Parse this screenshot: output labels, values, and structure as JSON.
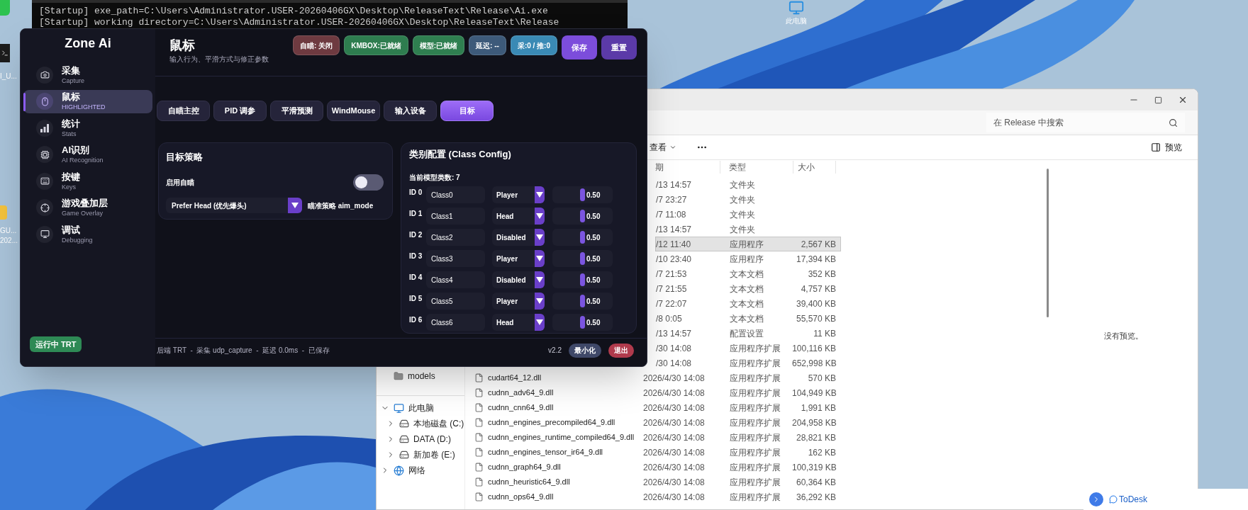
{
  "console": {
    "lines": [
      "[Startup] exe_path=C:\\Users\\Administrator.USER-20260406GX\\Desktop\\ReleaseText\\Release\\Ai.exe",
      "[Startup] working directory=C:\\Users\\Administrator.USER-20260406GX\\Desktop\\ReleaseText\\Release"
    ]
  },
  "desktop": {
    "icons": [
      {
        "label": "此电脑"
      }
    ],
    "edge_labels": [
      "I_U...",
      "GU...",
      "202..."
    ]
  },
  "app": {
    "brand": "Zone Ai",
    "nav": [
      {
        "label": "采集",
        "sub": "Capture",
        "selected": false
      },
      {
        "label": "鼠标",
        "sub": "HIGHLIGHTED",
        "selected": true
      },
      {
        "label": "统计",
        "sub": "Stats",
        "selected": false
      },
      {
        "label": "AI识别",
        "sub": "AI Recognition",
        "selected": false
      },
      {
        "label": "按键",
        "sub": "Keys",
        "selected": false
      },
      {
        "label": "游戏叠加层",
        "sub": "Game Overlay",
        "selected": false
      },
      {
        "label": "调试",
        "sub": "Debugging",
        "selected": false
      }
    ],
    "run_button": "运行中 TRT",
    "header": {
      "title": "鼠标",
      "subtitle": "输入行为、平滑方式与修正参数"
    },
    "status_pills": [
      {
        "label": "自瞄: 关闭",
        "color": "#6e3a40"
      },
      {
        "label": "KMBOX:已就绪",
        "color": "#2e7d4f"
      },
      {
        "label": "模型:已就绪",
        "color": "#2f7f50"
      },
      {
        "label": "延迟: --",
        "color": "#3d5a7a"
      },
      {
        "label": "采:0 / 推:0",
        "color": "#3a8ab5"
      }
    ],
    "actions": [
      "保存",
      "重置"
    ],
    "tabs": [
      {
        "label": "自瞄主控",
        "selected": false
      },
      {
        "label": "PID 调参",
        "selected": false
      },
      {
        "label": "平滑预测",
        "selected": false
      },
      {
        "label": "WindMouse",
        "selected": false
      },
      {
        "label": "输入设备",
        "selected": false
      },
      {
        "label": "目标",
        "selected": true
      }
    ],
    "target_panel": {
      "title": "目标策略",
      "toggle": {
        "label": "启用自瞄",
        "on": false
      },
      "select": {
        "value": "Prefer Head (优先爆头)",
        "label": "瞄准策略 aim_mode"
      }
    },
    "class_panel": {
      "title": "类别配置 (Class Config)",
      "count": "当前模型类数: 7",
      "rows": [
        {
          "id": "ID 0",
          "name": "Class0",
          "type": "Player",
          "reading": "0.50",
          "level": 0.5
        },
        {
          "id": "ID 1",
          "name": "Class1",
          "type": "Head",
          "reading": "0.50",
          "level": 0.5
        },
        {
          "id": "ID 2",
          "name": "Class2",
          "type": "Disabled",
          "reading": "0.50",
          "level": 0.5
        },
        {
          "id": "ID 3",
          "name": "Class3",
          "type": "Player",
          "reading": "0.50",
          "level": 0.5
        },
        {
          "id": "ID 4",
          "name": "Class4",
          "type": "Disabled",
          "reading": "0.50",
          "level": 0.5
        },
        {
          "id": "ID 5",
          "name": "Class5",
          "type": "Player",
          "reading": "0.50",
          "level": 0.5
        },
        {
          "id": "ID 6",
          "name": "Class6",
          "type": "Head",
          "reading": "0.50",
          "level": 0.5
        }
      ]
    },
    "status_bar": {
      "text": "后端 TRT  -  采集 udp_capture  -  延迟 0.0ms  -  已保存",
      "version": "v2.2",
      "buttons": [
        {
          "label": "最小化",
          "kind": "neutral"
        },
        {
          "label": "退出",
          "kind": "danger"
        }
      ]
    }
  },
  "explorer": {
    "search": {
      "placeholder": "在 Release 中搜索"
    },
    "toolbar": {
      "view": "查看",
      "preview": "预览"
    },
    "nav": [
      {
        "label": "models",
        "kind": "folder"
      },
      {
        "label": "此电脑",
        "kind": "pc",
        "expanded": true,
        "children": [
          {
            "label": "本地磁盘 (C:)",
            "kind": "drive",
            "expanded": false
          },
          {
            "label": "DATA (D:)",
            "kind": "drive",
            "expanded": false
          },
          {
            "label": "新加卷 (E:)",
            "kind": "drive",
            "expanded": false
          }
        ]
      },
      {
        "label": "网络",
        "kind": "network",
        "expanded": false
      }
    ],
    "columns": [
      "期",
      "类型",
      "大小"
    ],
    "rows": [
      {
        "date": "/13 14:57",
        "type": "文件夹",
        "selected": false
      },
      {
        "date": "/7 23:27",
        "type": "文件夹",
        "selected": false
      },
      {
        "date": "/7 11:08",
        "type": "文件夹",
        "selected": false
      },
      {
        "date": "/13 14:57",
        "type": "文件夹",
        "selected": false
      },
      {
        "date": "/12 11:40",
        "type": "应用程序",
        "size": "2,567 KB",
        "selected": true
      },
      {
        "date": "/10 23:40",
        "type": "应用程序",
        "size": "17,394 KB",
        "selected": false
      },
      {
        "date": "/7 21:53",
        "type": "文本文档",
        "size": "352 KB",
        "selected": false
      },
      {
        "date": "/7 21:55",
        "type": "文本文档",
        "size": "4,757 KB",
        "selected": false
      },
      {
        "date": "/7 22:07",
        "type": "文本文档",
        "size": "39,400 KB",
        "selected": false
      },
      {
        "date": "/8 0:05",
        "type": "文本文档",
        "size": "55,570 KB",
        "selected": false
      },
      {
        "date": "/13 14:57",
        "type": "配置设置",
        "size": "11 KB",
        "selected": false
      },
      {
        "date": "/30 14:08",
        "type": "应用程序扩展",
        "size": "100,116 KB",
        "selected": false
      },
      {
        "date": "/30 14:08",
        "type": "应用程序扩展",
        "size": "652,998 KB",
        "selected": false
      },
      {
        "name": "cudart64_12.dll",
        "date": "2026/4/30 14:08",
        "type": "应用程序扩展",
        "size": "570 KB",
        "selected": false
      },
      {
        "name": "cudnn_adv64_9.dll",
        "date": "2026/4/30 14:08",
        "type": "应用程序扩展",
        "size": "104,949 KB",
        "selected": false
      },
      {
        "name": "cudnn_cnn64_9.dll",
        "date": "2026/4/30 14:08",
        "type": "应用程序扩展",
        "size": "1,991 KB",
        "selected": false
      },
      {
        "name": "cudnn_engines_precompiled64_9.dll",
        "date": "2026/4/30 14:08",
        "type": "应用程序扩展",
        "size": "204,958 KB",
        "selected": false
      },
      {
        "name": "cudnn_engines_runtime_compiled64_9.dll",
        "date": "2026/4/30 14:08",
        "type": "应用程序扩展",
        "size": "28,821 KB",
        "selected": false
      },
      {
        "name": "cudnn_engines_tensor_ir64_9.dll",
        "date": "2026/4/30 14:08",
        "type": "应用程序扩展",
        "size": "162 KB",
        "selected": false
      },
      {
        "name": "cudnn_graph64_9.dll",
        "date": "2026/4/30 14:08",
        "type": "应用程序扩展",
        "size": "100,319 KB",
        "selected": false
      },
      {
        "name": "cudnn_heuristic64_9.dll",
        "date": "2026/4/30 14:08",
        "type": "应用程序扩展",
        "size": "60,364 KB",
        "selected": false
      },
      {
        "name": "cudnn_ops64_9.dll",
        "date": "2026/4/30 14:08",
        "type": "应用程序扩展",
        "size": "36,292 KB",
        "selected": false
      }
    ],
    "preview_text": "没有预览。"
  },
  "todesk": {
    "label": "ToDesk"
  }
}
